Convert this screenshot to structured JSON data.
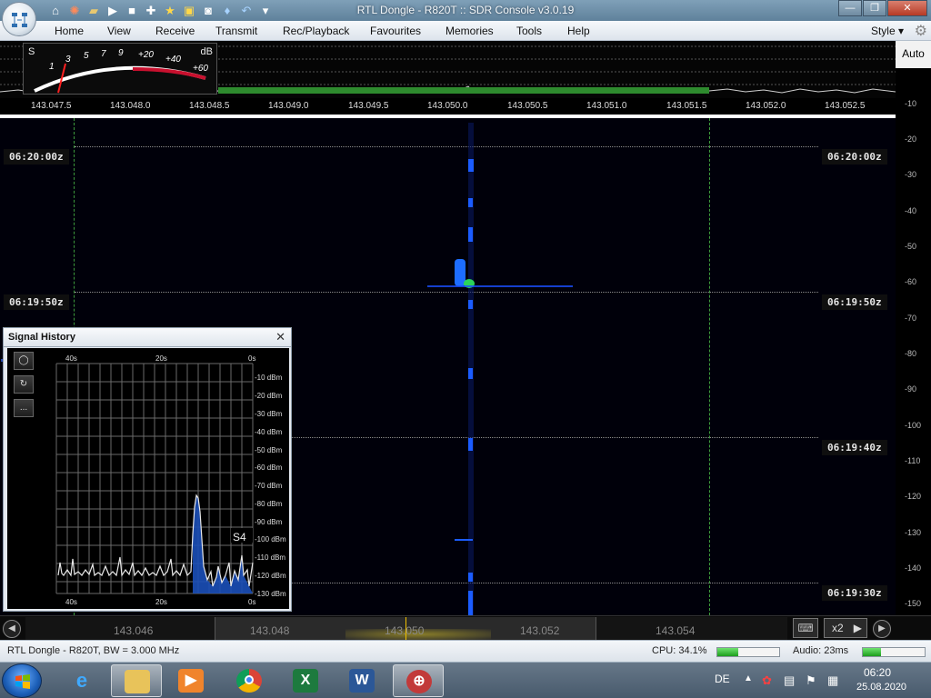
{
  "window": {
    "title": "RTL Dongle - R820T :: SDR Console v3.0.19",
    "controls": [
      "minimize",
      "maximize",
      "close"
    ]
  },
  "quick_access": [
    "home-icon",
    "lifebuoy-icon",
    "folder-icon",
    "play-icon",
    "stop-icon",
    "add-icon",
    "star-icon",
    "lock-icon",
    "camera-icon",
    "drop-icon",
    "undo-icon",
    "dropdown-icon"
  ],
  "menu": {
    "items": [
      "Home",
      "View",
      "Receive",
      "Transmit",
      "Rec/Playback",
      "Favourites",
      "Memories",
      "Tools",
      "Help"
    ],
    "style_label": "Style"
  },
  "smeter": {
    "s_label": "S",
    "db_label": "dB",
    "scale": [
      "1",
      "3",
      "5",
      "7",
      "9",
      "+20",
      "+40",
      "+60"
    ]
  },
  "auto_button": "Auto",
  "spectrum_axis": [
    "143.047.5",
    "143.048.0",
    "143.048.5",
    "143.049.0",
    "143.049.5",
    "143.050.0",
    "143.050.5",
    "143.051.0",
    "143.051.5",
    "143.052.0",
    "143.052.5"
  ],
  "waterfall": {
    "time_labels": [
      "06:20:00z",
      "06:19:50z",
      "06:19:40z",
      "06:19:30z"
    ]
  },
  "db_scale": [
    "-10",
    "-20",
    "-30",
    "-40",
    "-50",
    "-60",
    "-70",
    "-80",
    "-90",
    "-100",
    "-110",
    "-120",
    "-130",
    "-140",
    "-150"
  ],
  "signal_history": {
    "title": "Signal History",
    "time_top": [
      "40s",
      "20s",
      "0s"
    ],
    "time_bottom": [
      "40s",
      "20s",
      "0s"
    ],
    "levels": [
      "-10 dBm",
      "-20 dBm",
      "-30 dBm",
      "-40 dBm",
      "-50 dBm",
      "-60 dBm",
      "-70 dBm",
      "-80 dBm",
      "-90 dBm",
      "-100 dBm",
      "-110 dBm",
      "-120 dBm",
      "-130 dBm"
    ],
    "s_reading": "S4",
    "tools": [
      "circle-icon",
      "refresh-icon",
      "more-icon"
    ],
    "more_label": "..."
  },
  "bottom_ruler": {
    "labels": [
      "143.046",
      "143.048",
      "143.050",
      "143.052",
      "143.054"
    ],
    "zoom": "x2"
  },
  "status": {
    "device": "RTL Dongle - R820T, BW = 3.000 MHz",
    "cpu": "CPU: 34.1%",
    "cpu_level": 0.34,
    "audio": "Audio: 23ms",
    "audio_level": 0.3
  },
  "taskbar": {
    "apps": [
      "ie-icon",
      "explorer-icon",
      "media-player-icon",
      "chrome-icon",
      "excel-icon",
      "word-icon",
      "sdr-console-icon"
    ],
    "language": "DE",
    "time": "06:20",
    "date": "25.08.2020"
  }
}
